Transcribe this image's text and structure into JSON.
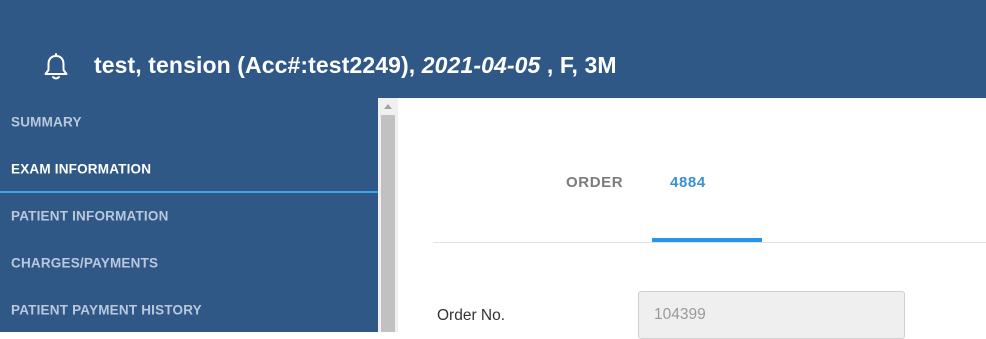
{
  "header": {
    "name_acc": "test, tension (Acc#:test2249), ",
    "dob": "2021-04-05",
    "details": " , F, 3M",
    "icon": "bell-icon"
  },
  "sidebar": {
    "items": [
      {
        "label": "SUMMARY",
        "active": false
      },
      {
        "label": "EXAM INFORMATION",
        "active": true
      },
      {
        "label": "PATIENT INFORMATION",
        "active": false
      },
      {
        "label": "CHARGES/PAYMENTS",
        "active": false
      },
      {
        "label": "PATIENT PAYMENT HISTORY",
        "active": false
      }
    ]
  },
  "tabs": {
    "order_label": "ORDER",
    "order_number": "4884"
  },
  "form": {
    "order_no_label": "Order No.",
    "order_no_value": "104399"
  },
  "colors": {
    "header_bg": "#2f5886",
    "accent": "#2196f3"
  }
}
